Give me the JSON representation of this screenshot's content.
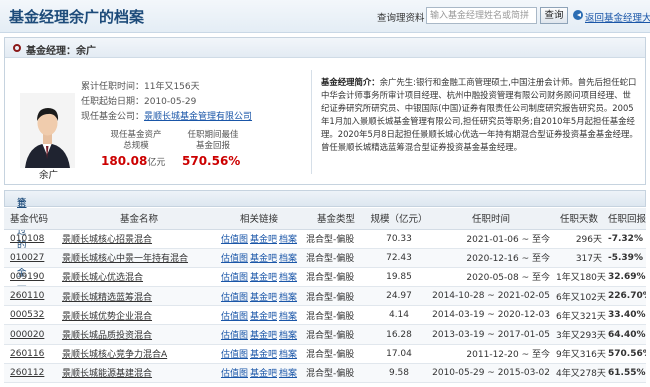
{
  "header": {
    "title": "基金经理余广的档案",
    "search_label": "查询理资料：",
    "search_placeholder": "输入基金经理姓名或简拼",
    "search_button": "查询",
    "back_link": "返回基金经理大全"
  },
  "manager": {
    "section_title": "基金经理：余广",
    "name": "余广",
    "tenure_label": "累计任职时间：11年又156天",
    "start_label": "任职起始日期：2010-05-29",
    "company_prefix": "现任基金公司：",
    "company": "景顺长城基金管理有限公司",
    "aum_label_1": "现任基金资产",
    "aum_label_2": "总规模",
    "aum_value": "180.08",
    "aum_unit": "亿元",
    "best_label_1": "任职期间最佳",
    "best_label_2": "基金回报",
    "best_value": "570.56%",
    "bio_title": "基金经理简介：",
    "bio_text": "余广先生:银行和金融工商管理硕士,中国注册会计师。曾先后担任蛇口中华会计师事务所审计项目经理、杭州中融投资管理有限公司财务顾问项目经理、世纪证券研究所研究员、中银国际(中国)证券有限责任公司制度研究报告研究员。2005年1月加入景顺长城基金管理有限公司,担任研究员等职务;自2010年5月起担任基金经理。2020年5月8日起担任景顺长城心优选一年持有期混合型证券投资基金基金经理。曾任景顺长城精选蓝筹混合型证券投资基金基金经理。"
  },
  "funds_section": {
    "title_highlight": "余广",
    "title_rest": "管理过的基金一览",
    "columns": [
      "基金代码",
      "基金名称",
      "相关链接",
      "基金类型",
      "规模（亿元）",
      "任职时间",
      "任职天数",
      "任职回报"
    ],
    "link_labels": [
      "估值图",
      "基金吧",
      "档案"
    ],
    "rows": [
      {
        "code": "010108",
        "name": "景顺长城核心招景混合",
        "type": "混合型-偏股",
        "size": "70.33",
        "period": "2021-01-06 ~ 至今",
        "days": "296天",
        "return": "-7.32%",
        "sign": "neg"
      },
      {
        "code": "010027",
        "name": "景顺长城核心中景一年持有混合",
        "type": "混合型-偏股",
        "size": "72.43",
        "period": "2020-12-16 ~ 至今",
        "days": "317天",
        "return": "-5.39%",
        "sign": "neg"
      },
      {
        "code": "009190",
        "name": "景顺长城心优选混合",
        "type": "混合型-偏股",
        "size": "19.85",
        "period": "2020-05-08 ~ 至今",
        "days": "1年又180天",
        "return": "32.69%",
        "sign": "pos"
      },
      {
        "code": "260110",
        "name": "景顺长城精选蓝筹混合",
        "type": "混合型-偏股",
        "size": "24.97",
        "period": "2014-10-28 ~ 2021-02-05",
        "days": "6年又102天",
        "return": "226.70%",
        "sign": "pos"
      },
      {
        "code": "000532",
        "name": "景顺长城优势企业混合",
        "type": "混合型-偏股",
        "size": "4.14",
        "period": "2014-03-19 ~ 2020-12-03",
        "days": "6年又321天",
        "return": "33.40%",
        "sign": "pos"
      },
      {
        "code": "000020",
        "name": "景顺长城品质投资混合",
        "type": "混合型-偏股",
        "size": "16.28",
        "period": "2013-03-19 ~ 2017-01-05",
        "days": "3年又293天",
        "return": "64.40%",
        "sign": "pos"
      },
      {
        "code": "260116",
        "name": "景顺长城核心竞争力混合A",
        "type": "混合型-偏股",
        "size": "17.04",
        "period": "2011-12-20 ~ 至今",
        "days": "9年又316天",
        "return": "570.56%",
        "sign": "pos"
      },
      {
        "code": "260112",
        "name": "景顺长城能源基建混合",
        "type": "混合型-偏股",
        "size": "9.58",
        "period": "2010-05-29 ~ 2015-03-02",
        "days": "4年又278天",
        "return": "61.55%",
        "sign": "pos"
      }
    ]
  }
}
